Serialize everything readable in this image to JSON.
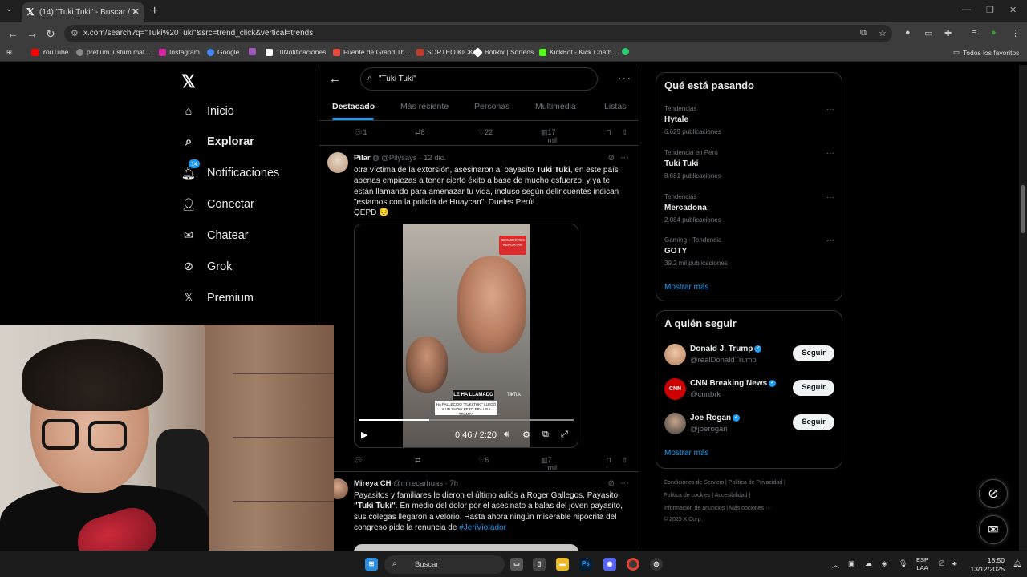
{
  "browser": {
    "tab_title": "(14) \"Tuki Tuki\" - Buscar / X",
    "url": "x.com/search?q=\"Tuki%20Tuki\"&src=trend_click&vertical=trends",
    "bookmarks": [
      {
        "label": "YouTube",
        "color": "#ff0000"
      },
      {
        "label": "pretium iustum mat...",
        "color": "#888888"
      },
      {
        "label": "Instagram",
        "color": "#d6249f"
      },
      {
        "label": "Google",
        "color": "#4285f4"
      },
      {
        "label": "",
        "color": "#9b59b6"
      },
      {
        "label": "10Notificaciones",
        "color": "#ffffff"
      },
      {
        "label": "Fuente de Grand Th...",
        "color": "#e74c3c"
      },
      {
        "label": "SORTEO KICK",
        "color": "#c0392b"
      },
      {
        "label": "BotRix | Sorteos",
        "color": "#ffffff"
      },
      {
        "label": "KickBot - Kick Chatb...",
        "color": "#53fc18"
      },
      {
        "label": "",
        "color": "#2ecc71"
      }
    ],
    "all_favorites": "Todos los favoritos"
  },
  "nav": {
    "items": [
      {
        "label": "Inicio"
      },
      {
        "label": "Explorar"
      },
      {
        "label": "Notificaciones",
        "badge": "14"
      },
      {
        "label": "Conectar"
      },
      {
        "label": "Chatear"
      },
      {
        "label": "Grok"
      },
      {
        "label": "Premium"
      }
    ]
  },
  "search": {
    "query": "\"Tuki Tuki\"",
    "tabs": [
      "Destacado",
      "Más reciente",
      "Personas",
      "Multimedia",
      "Listas"
    ]
  },
  "prev_actions": {
    "replies": "1",
    "reposts": "8",
    "likes": "22",
    "views": "17 mil"
  },
  "tweet1": {
    "name": "Pilar",
    "handle": "@Pilysays",
    "date": "12 dic.",
    "text_a": "otra víctima de la extorsión, asesinaron al payasito ",
    "text_b": "Tuki Tuki",
    "text_c": ", en este país apenas empiezas a tener cierto éxito a base de mucho esfuerzo, y ya te están llamando para amenazar tu vida, incluso según delincuentes indican \"estamos con la policía de Huaycan\". Dueles Perú!",
    "text_d": "QEPD 😔",
    "video_caption": "LE HA LLAMADO",
    "video_subcaption": "HA FALLECIDO \"TUKI TUKI\" LLEGÓ A UN SHOW PERO ERA UNA TRAMPA",
    "video_badge": "SEGUIDORES REPORTAN",
    "video_tiktok": "TikTok",
    "video_time": "0:46 / 2:20",
    "video_progress": 0.33,
    "actions": {
      "replies": "",
      "reposts": "",
      "likes": "6",
      "views": "7 mil"
    }
  },
  "tweet2": {
    "name": "Mireya CH",
    "handle": "@mirecarhuas",
    "date": "7h",
    "text_a": "Payasitos y familiares le dieron el último adiós a Roger Gallegos, Payasito ",
    "text_b": "\"Tuki Tuki\"",
    "text_c": ". En medio del dolor por el asesinato a balas del joven payasito, sus colegas llegaron a velorio. Hasta ahora ningún miserable hipócrita del congreso pide la renuncia de ",
    "text_tag": "#JeriVioIador"
  },
  "trending": {
    "title": "Qué está pasando",
    "items": [
      {
        "context": "Tendencias",
        "name": "Hytale",
        "count": "6.629 publicaciones"
      },
      {
        "context": "Tendencia en Perú",
        "name": "Tuki Tuki",
        "count": "8.681 publicaciones"
      },
      {
        "context": "Tendencias",
        "name": "Mercadona",
        "count": "2.084 publicaciones"
      },
      {
        "context": "Gaming · Tendencia",
        "name": "GOTY",
        "count": "39,2 mil publicaciones"
      }
    ],
    "show_more": "Mostrar más"
  },
  "who_to_follow": {
    "title": "A quién seguir",
    "items": [
      {
        "name": "Donald J. Trump",
        "handle": "@realDonaldTrump",
        "button": "Seguir"
      },
      {
        "name": "CNN Breaking News",
        "handle": "@cnnbrk",
        "button": "Seguir"
      },
      {
        "name": "Joe Rogan",
        "handle": "@joerogan",
        "button": "Seguir"
      }
    ],
    "show_more": "Mostrar más"
  },
  "footer": {
    "line1": "Condiciones de Servicio  |  Política de Privacidad  |",
    "line2": "Política de cookies  |  Accesibilidad  |",
    "line3": "Información de anuncios  |  Más opciones ···",
    "line4": "© 2025 X Corp."
  },
  "taskbar": {
    "search": "Buscar",
    "lang1": "ESP",
    "lang2": "LAA",
    "time": "18:50",
    "date": "13/12/2025"
  },
  "colors": {
    "accent": "#1d9bf0",
    "bg": "#000000",
    "border": "#2f3336"
  }
}
